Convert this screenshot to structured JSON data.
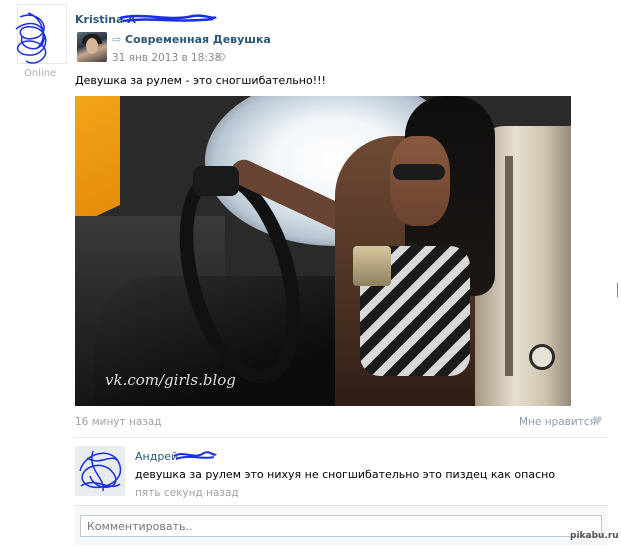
{
  "author": {
    "name": "Kristina A",
    "status": "Online"
  },
  "repost": {
    "source": "Современная Девушка",
    "date": "31 янв 2013 в 18:38"
  },
  "post": {
    "text": "Девушка за рулем - это сногшибательно!!!",
    "photo_watermark": "vk.com/girls.blog",
    "time": "16 минут назад",
    "like_label": "Мне нравится"
  },
  "comment": {
    "author": "Андрей",
    "text": "девушка за рулем это нихуя не сногшибательно это пиздец как опасно",
    "time": "пять секунд назад"
  },
  "comment_input": {
    "placeholder": "Комментировать.."
  },
  "site": {
    "watermark": "pikabu.ru"
  },
  "colors": {
    "link": "#2b587a",
    "muted": "#a0a0a0",
    "scribble": "#1a2fe0"
  },
  "icons": {
    "repost": "repost-arrow-icon",
    "settings": "gear-icon",
    "like": "heart-icon"
  }
}
